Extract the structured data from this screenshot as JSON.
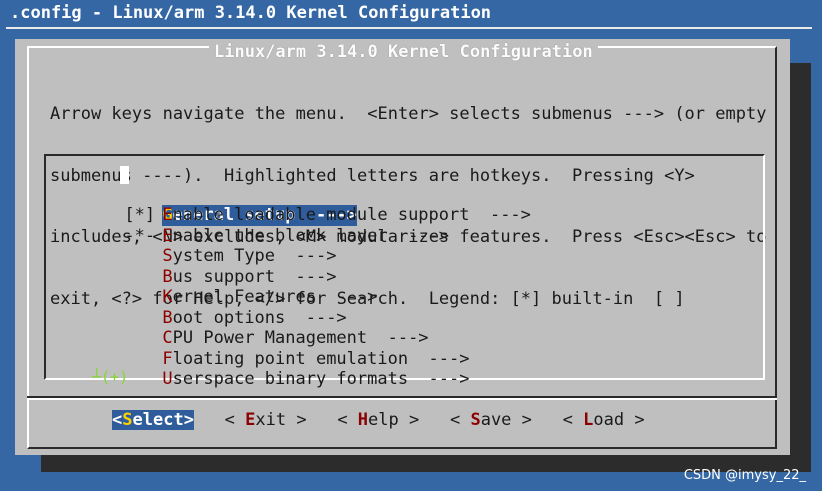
{
  "window_title": ".config - Linux/arm 3.14.0 Kernel Configuration",
  "dialog": {
    "title": "Linux/arm 3.14.0 Kernel Configuration",
    "help_lines": [
      "Arrow keys navigate the menu.  <Enter> selects submenus ---> (or empty",
      "submenus ----).  Highlighted letters are hotkeys.  Pressing <Y>",
      "includes, <N> excludes, <M> modularizes features.  Press <Esc><Esc> to",
      "exit, <?> for Help, </> for Search.  Legend: [*] built-in  [ ]"
    ]
  },
  "menu": {
    "items": [
      {
        "prefix": "",
        "hotkey": "G",
        "rest": "eneral setup  --->",
        "selected": true
      },
      {
        "prefix": "[*]",
        "hotkey": "E",
        "rest": "nable loadable module support  --->",
        "selected": false
      },
      {
        "prefix": "-*-",
        "hotkey": "E",
        "rest": "nable the block layer  --->",
        "selected": false
      },
      {
        "prefix": "",
        "hotkey": "S",
        "rest": "ystem Type  --->",
        "selected": false
      },
      {
        "prefix": "",
        "hotkey": "B",
        "rest": "us support  --->",
        "selected": false
      },
      {
        "prefix": "",
        "hotkey": "K",
        "rest": "ernel Features  --->",
        "selected": false
      },
      {
        "prefix": "",
        "hotkey": "B",
        "rest": "oot options  --->",
        "selected": false
      },
      {
        "prefix": "",
        "hotkey": "C",
        "rest": "PU Power Management  --->",
        "selected": false
      },
      {
        "prefix": "",
        "hotkey": "F",
        "rest": "loating point emulation  --->",
        "selected": false
      },
      {
        "prefix": "",
        "hotkey": "U",
        "rest": "serspace binary formats  --->",
        "selected": false
      }
    ],
    "more_indicator": "┴(+)"
  },
  "buttons": [
    {
      "left": "<",
      "hotkey": "S",
      "rest": "elect",
      "right": ">",
      "active": true
    },
    {
      "left": "< ",
      "hotkey": "E",
      "rest": "xit",
      "right": " >",
      "active": false
    },
    {
      "left": "< ",
      "hotkey": "H",
      "rest": "elp",
      "right": " >",
      "active": false
    },
    {
      "left": "< ",
      "hotkey": "S",
      "rest": "ave",
      "right": " >",
      "active": false
    },
    {
      "left": "< ",
      "hotkey": "L",
      "rest": "oad",
      "right": " >",
      "active": false
    }
  ],
  "watermark": "CSDN @imysy_22_",
  "colors": {
    "background": "#3467a4",
    "dialog": "#bfbfbf",
    "highlight": "#2f5d9c",
    "hotkey_selected": "#ffd200",
    "hotkey": "#8b0000"
  }
}
